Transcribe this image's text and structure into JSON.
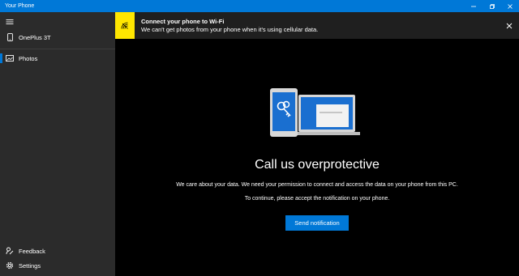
{
  "window": {
    "title": "Your Phone"
  },
  "sidebar": {
    "device_name": "OnePlus 3T",
    "items": [
      {
        "label": "Photos",
        "icon": "photos-icon",
        "selected": true
      }
    ],
    "bottom_items": [
      {
        "label": "Feedback",
        "icon": "feedback-icon"
      },
      {
        "label": "Settings",
        "icon": "gear-icon"
      }
    ]
  },
  "banner": {
    "title": "Connect your phone to Wi-Fi",
    "text": "We can't get photos from your phone when it's using cellular data.",
    "icon": "wifi-off-icon"
  },
  "main": {
    "heading": "Call us overprotective",
    "paragraph1": "We care about your data. We need your permission to connect and access the data on your phone from this PC.",
    "paragraph2": "To continue, please accept the notification on your phone.",
    "button_label": "Send notification"
  },
  "colors": {
    "accent": "#0078d7",
    "banner_icon_bg": "#ffe600",
    "sidebar_bg": "#2b2b2b",
    "main_bg": "#000000"
  }
}
